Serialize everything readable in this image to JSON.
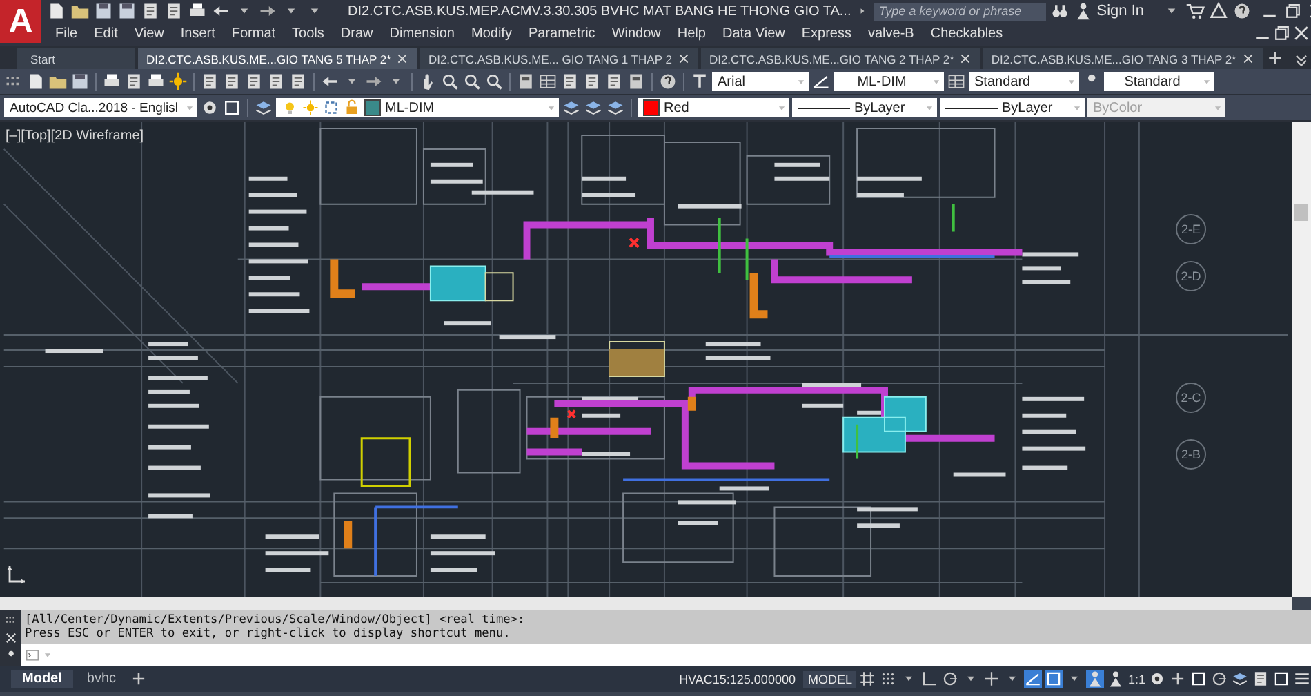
{
  "app_logo": {
    "letter": "A"
  },
  "window": {
    "title": "DI2.CTC.ASB.KUS.MEP.ACMV.3.30.305 BVHC MAT BANG HE THONG GIO TA...",
    "search": {
      "placeholder": "Type a keyword or phrase"
    },
    "sign_in": "Sign In"
  },
  "menu": [
    "File",
    "Edit",
    "View",
    "Insert",
    "Format",
    "Tools",
    "Draw",
    "Dimension",
    "Modify",
    "Parametric",
    "Window",
    "Help",
    "Data View",
    "Express",
    "valve-B",
    "Checkables"
  ],
  "tabs": [
    {
      "label": "Start",
      "selected": false
    },
    {
      "label": "DI2.CTC.ASB.KUS.ME...GIO TANG 5 THAP 2*",
      "selected": true
    },
    {
      "label": "DI2.CTC.ASB.KUS.ME... GIO TANG 1 THAP 2",
      "selected": false
    },
    {
      "label": "DI2.CTC.ASB.KUS.ME...GIO TANG 2 THAP 2*",
      "selected": false
    },
    {
      "label": "DI2.CTC.ASB.KUS.ME...GIO TANG 3 THAP 2*",
      "selected": false
    }
  ],
  "styles_toolbar": {
    "text_style": "Arial",
    "dim_style": "ML-DIM",
    "table_style": "Standard",
    "multileader_style": "Standard"
  },
  "properties_toolbar": {
    "workspace": "AutoCAD Cla...2018 - Englisl",
    "layer": "ML-DIM",
    "color": {
      "label": "Red",
      "color": "#ff0000"
    },
    "linetype": "ByLayer",
    "lineweight": "ByLayer",
    "plot_style": {
      "label": "ByColor",
      "disabled": true
    }
  },
  "viewport": {
    "label": "[–][Top][2D Wireframe]",
    "grid_bubbles": [
      "2-E",
      "2-D",
      "2-C",
      "2-B"
    ]
  },
  "command_line": {
    "history": [
      "[All/Center/Dynamic/Extents/Previous/Scale/Window/Object] <real time>:",
      "Press ESC or ENTER to exit, or right-click to display shortcut menu."
    ]
  },
  "layout_tabs": [
    {
      "label": "Model",
      "selected": true
    },
    {
      "label": "bvhc",
      "selected": false
    }
  ],
  "status_bar": {
    "coordinates": "HVAC15:125.000000",
    "space": "MODEL",
    "scale": "1:1",
    "toggles": [
      {
        "kind": "grid",
        "on": false
      },
      {
        "kind": "snap",
        "on": false
      },
      {
        "kind": "ortho",
        "on": false
      },
      {
        "kind": "polar",
        "on": false
      },
      {
        "kind": "osnap-track",
        "on": false
      },
      {
        "kind": "iso",
        "on": true
      },
      {
        "kind": "osnap",
        "on": true
      },
      {
        "kind": "annovis",
        "on": true
      },
      {
        "kind": "autoscale",
        "on": false
      }
    ]
  }
}
